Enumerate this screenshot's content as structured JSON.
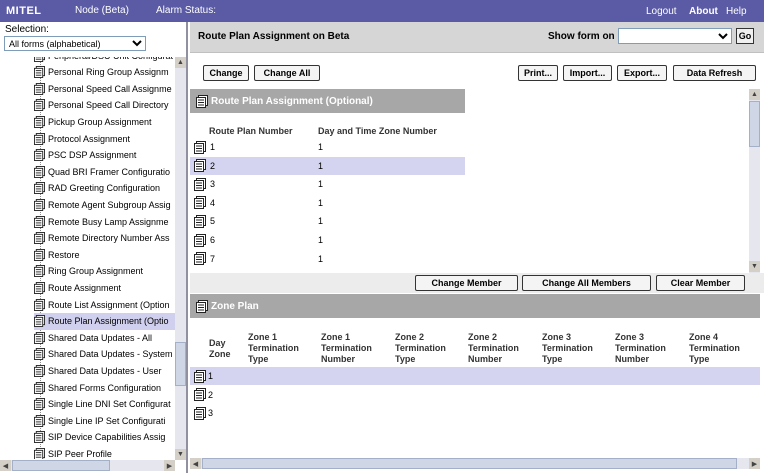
{
  "header": {
    "logo": "MITEL",
    "node": "Node (Beta)",
    "alarm": "Alarm Status:",
    "logout": "Logout",
    "about": "About",
    "help": "Help"
  },
  "sidebar": {
    "selection_label": "Selection:",
    "filter_value": "All forms (alphabetical)",
    "items": [
      "Peripheral/DSU Unit Configurat",
      "Personal Ring Group Assignm",
      "Personal Speed Call Assignme",
      "Personal Speed Call Directory",
      "Pickup Group Assignment",
      "Protocol Assignment",
      "PSC DSP Assignment",
      "Quad BRI Framer Configuratio",
      "RAD Greeting Configuration",
      "Remote Agent Subgroup Assig",
      "Remote Busy Lamp Assignme",
      "Remote Directory Number Ass",
      "Restore",
      "Ring Group Assignment",
      "Route Assignment",
      "Route List Assignment (Option",
      "Route Plan Assignment (Optio",
      "Shared Data Updates - All",
      "Shared Data Updates - System",
      "Shared Data Updates - User",
      "Shared Forms Configuration",
      "Single Line DNI Set Configurat",
      "Single Line IP Set Configurati",
      "SIP Device Capabilities Assig",
      "SIP Peer Profile"
    ]
  },
  "titlebar": {
    "title": "Route Plan Assignment on Beta",
    "show_form_label": "Show form on",
    "show_form_value": "",
    "go_label": "Go"
  },
  "toolbar": {
    "change": "Change",
    "change_all": "Change All",
    "print": "Print...",
    "import": "Import...",
    "export": "Export...",
    "data_refresh": "Data Refresh"
  },
  "route_plan": {
    "heading": "Route Plan Assignment (Optional)",
    "col1": "Route Plan Number",
    "col2": "Day and Time Zone Number",
    "rows": [
      {
        "num": "1",
        "zone": "1"
      },
      {
        "num": "2",
        "zone": "1"
      },
      {
        "num": "3",
        "zone": "1"
      },
      {
        "num": "4",
        "zone": "1"
      },
      {
        "num": "5",
        "zone": "1"
      },
      {
        "num": "6",
        "zone": "1"
      },
      {
        "num": "7",
        "zone": "1"
      }
    ]
  },
  "member_buttons": {
    "change_member": "Change Member",
    "change_all_members": "Change All Members",
    "clear_member": "Clear Member"
  },
  "zone_plan": {
    "heading": "Zone Plan",
    "cols": [
      "Day\nZone",
      "Zone 1\nTermination\nType",
      "Zone 1\nTermination\nNumber",
      "Zone 2\nTermination\nType",
      "Zone 2\nTermination\nNumber",
      "Zone 3\nTermination\nType",
      "Zone 3\nTermination\nNumber",
      "Zone 4\nTermination\nType"
    ],
    "rows": [
      "1",
      "2",
      "3"
    ]
  }
}
